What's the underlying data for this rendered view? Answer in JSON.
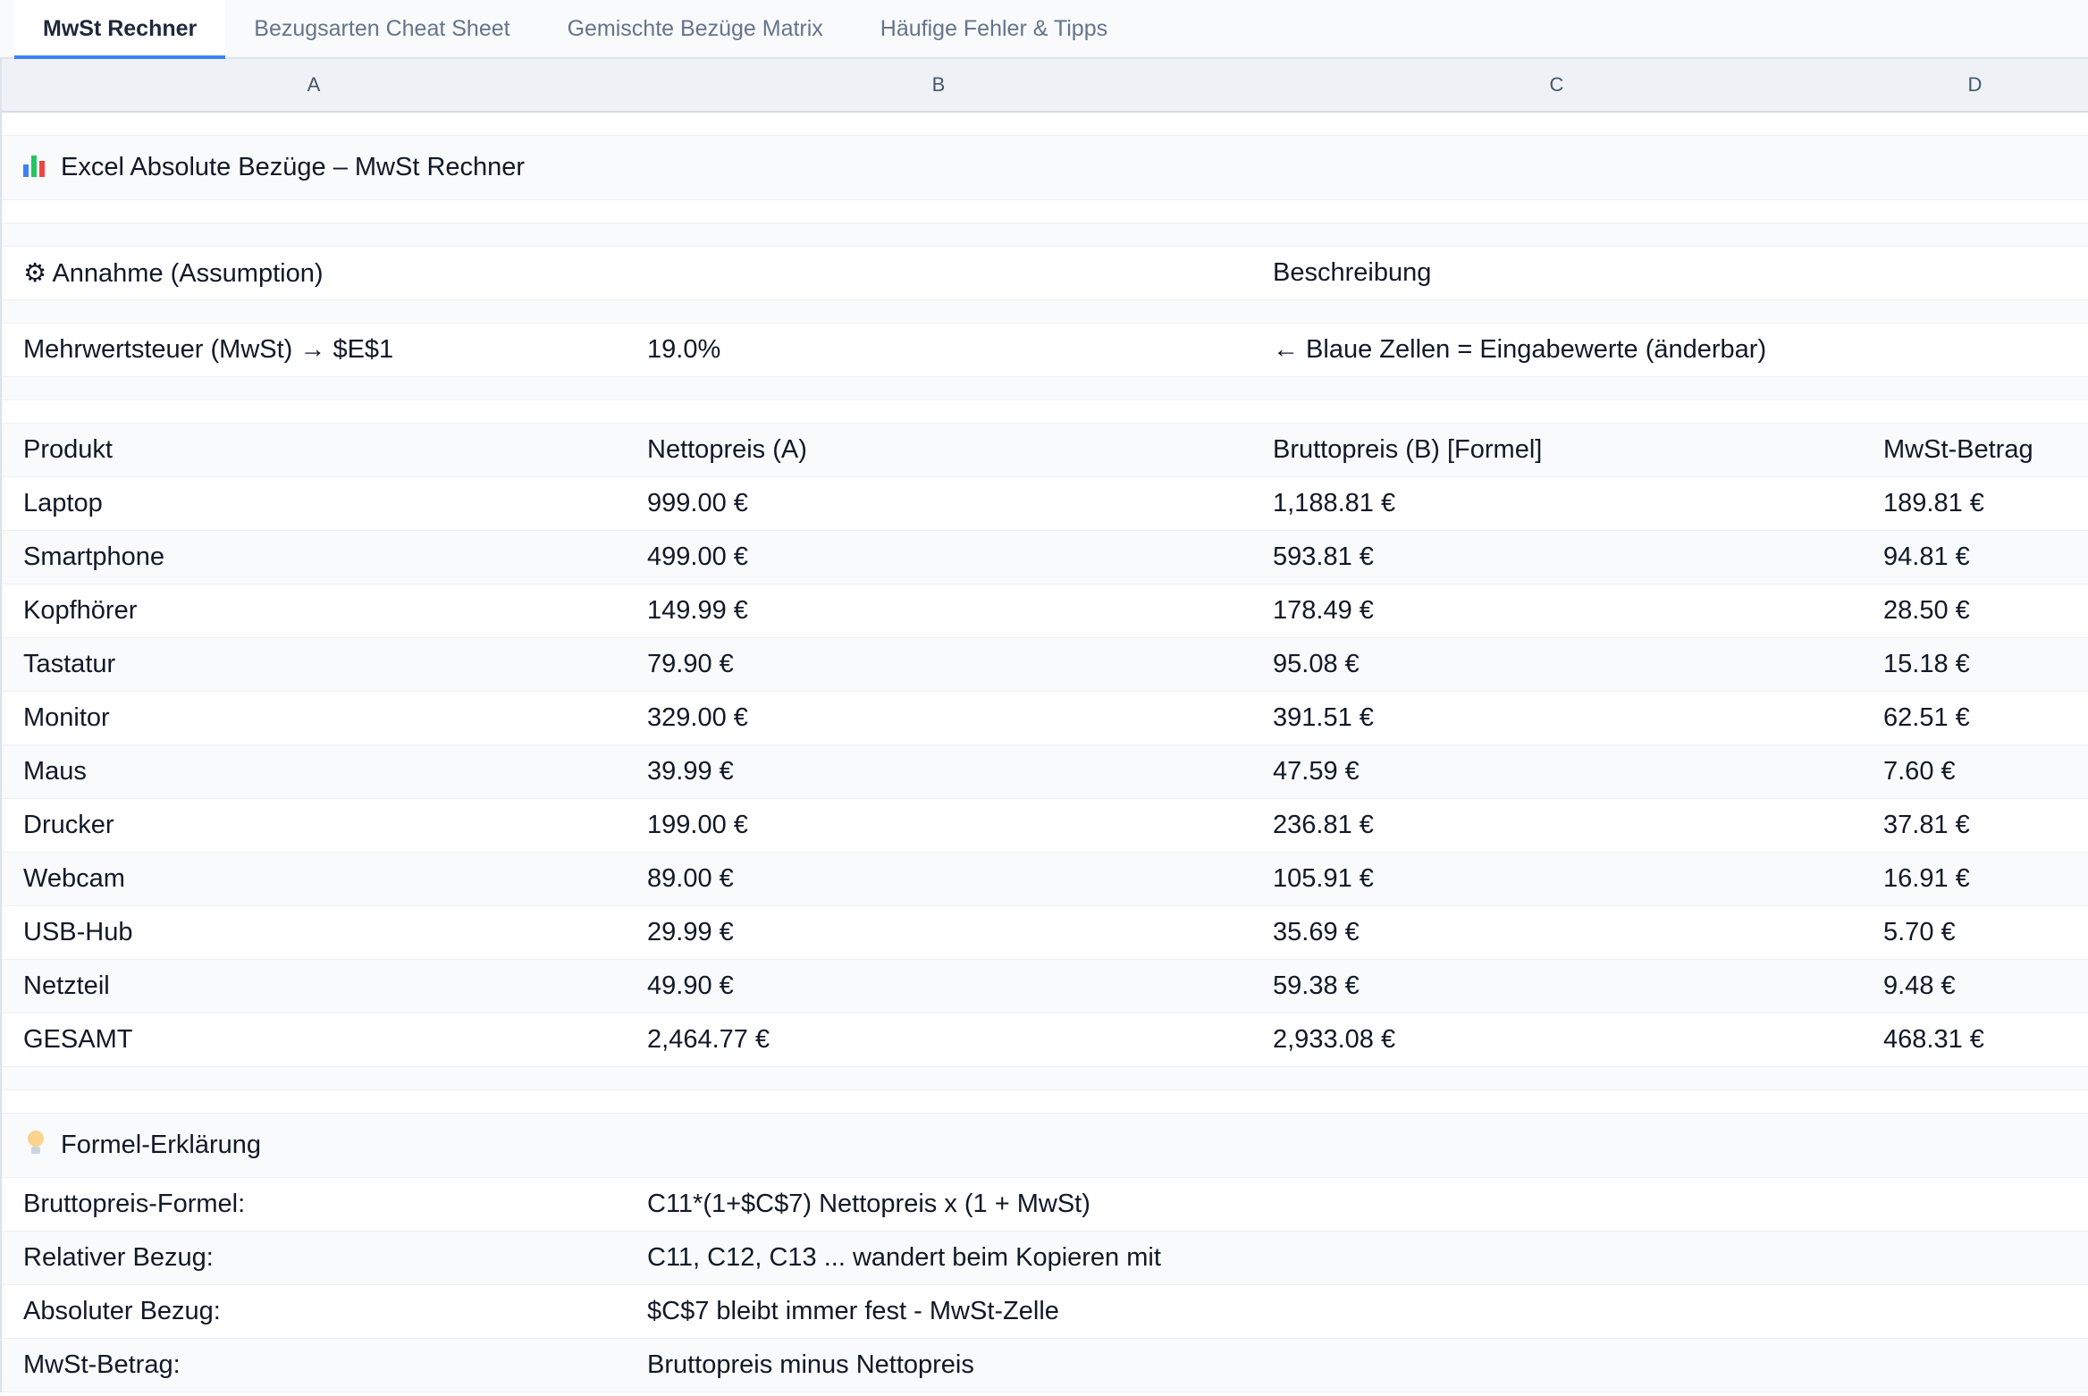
{
  "tabs": [
    {
      "label": "MwSt Rechner",
      "active": true
    },
    {
      "label": "Bezugsarten Cheat Sheet",
      "active": false
    },
    {
      "label": "Gemischte Bezüge Matrix",
      "active": false
    },
    {
      "label": "Häufige Fehler & Tipps",
      "active": false
    }
  ],
  "columns": [
    "A",
    "B",
    "C",
    "D"
  ],
  "title": {
    "icon": "bar-chart-icon",
    "text": "Excel Absolute Bezüge – MwSt Rechner"
  },
  "assumption_header": {
    "a": "⚙ Annahme (Assumption)",
    "c": "Beschreibung"
  },
  "assumption_row": {
    "a": "Mehrwertsteuer (MwSt) → $E$1",
    "b": "19.0%",
    "c": "← Blaue Zellen = Eingabewerte (änderbar)"
  },
  "table_header": [
    "Produkt",
    "Nettopreis (A)",
    "Bruttopreis (B) [Formel]",
    "MwSt-Betrag"
  ],
  "products": [
    [
      "Laptop",
      "999.00 €",
      "1,188.81 €",
      "189.81 €"
    ],
    [
      "Smartphone",
      "499.00 €",
      "593.81 €",
      "94.81 €"
    ],
    [
      "Kopfhörer",
      "149.99 €",
      "178.49 €",
      "28.50 €"
    ],
    [
      "Tastatur",
      "79.90 €",
      "95.08 €",
      "15.18 €"
    ],
    [
      "Monitor",
      "329.00 €",
      "391.51 €",
      "62.51 €"
    ],
    [
      "Maus",
      "39.99 €",
      "47.59 €",
      "7.60 €"
    ],
    [
      "Drucker",
      "199.00 €",
      "236.81 €",
      "37.81 €"
    ],
    [
      "Webcam",
      "89.00 €",
      "105.91 €",
      "16.91 €"
    ],
    [
      "USB-Hub",
      "29.99 €",
      "35.69 €",
      "5.70 €"
    ],
    [
      "Netzteil",
      "49.90 €",
      "59.38 €",
      "9.48 €"
    ],
    [
      "GESAMT",
      "2,464.77 €",
      "2,933.08 €",
      "468.31 €"
    ]
  ],
  "explain_title": {
    "icon": "lightbulb-icon",
    "text": "Formel-Erklärung"
  },
  "explanations": [
    [
      "Bruttopreis-Formel:",
      "C11*(1+$C$7) Nettopreis x (1 + MwSt)"
    ],
    [
      "Relativer Bezug:",
      "C11, C12, C13 ... wandert beim Kopieren mit"
    ],
    [
      "Absoluter Bezug:",
      "$C$7 bleibt immer fest - MwSt-Zelle"
    ],
    [
      "MwSt-Betrag:",
      "Bruttopreis minus Nettopreis"
    ]
  ]
}
